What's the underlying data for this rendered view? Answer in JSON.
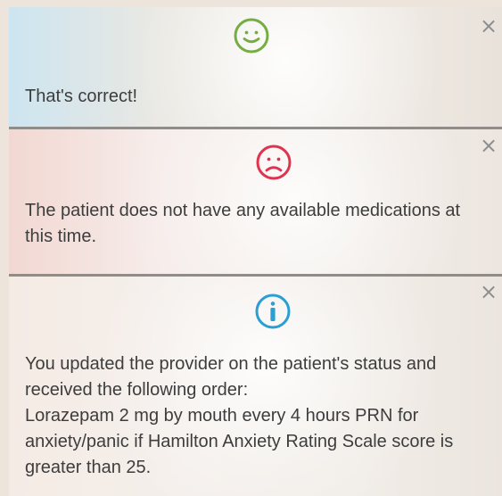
{
  "feedback": {
    "close_symbol": "×",
    "success": {
      "message": "That's correct!",
      "icon": "smiley-face-icon",
      "color": "#74ad41"
    },
    "error": {
      "message": "The patient does not have any available medications at this time.",
      "icon": "sad-face-icon",
      "color": "#e0334e"
    },
    "info": {
      "message": "You updated the provider on the patient's status and received the following order:\n Lorazepam 2 mg by mouth every 4 hours PRN for anxiety/panic if Hamilton Anxiety Rating Scale score is greater than 25.",
      "icon": "info-icon",
      "color": "#2b9fd3"
    }
  }
}
